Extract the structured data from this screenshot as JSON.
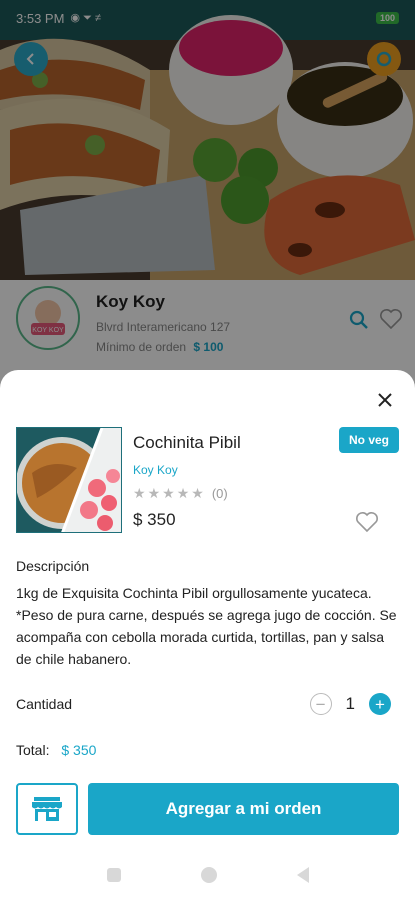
{
  "status_bar": {
    "time": "3:53 PM",
    "battery": "100"
  },
  "restaurant": {
    "name": "Koy Koy",
    "address": "Blvrd Interamericano 127",
    "min_order_label": "Mínimo de orden",
    "min_order_value": "$ 100",
    "logo_text": "KOY KOY"
  },
  "product": {
    "name": "Cochinita Pibil",
    "restaurant": "Koy Koy",
    "rating_count": "(0)",
    "stars": 0,
    "price": "$ 350",
    "badge": "No veg",
    "description_title": "Descripción",
    "description": "1kg de Exquisita Cochinta Pibil orgullosamente yucateca. *Peso de pura carne, después se agrega jugo de cocción. Se acompaña con cebolla morada curtida, tortillas, pan y salsa de chile habanero."
  },
  "quantity": {
    "label": "Cantidad",
    "value": "1"
  },
  "total": {
    "label": "Total:",
    "value": "$ 350"
  },
  "actions": {
    "add_label": "Agregar a mi orden"
  },
  "colors": {
    "accent": "#1aa6c8",
    "text": "#222222"
  },
  "icons": {
    "back": "arrow-left-icon",
    "share": "share-icon",
    "search": "search-icon",
    "heart": "heart-icon",
    "close": "close-icon",
    "store": "store-icon",
    "star": "star-icon"
  }
}
